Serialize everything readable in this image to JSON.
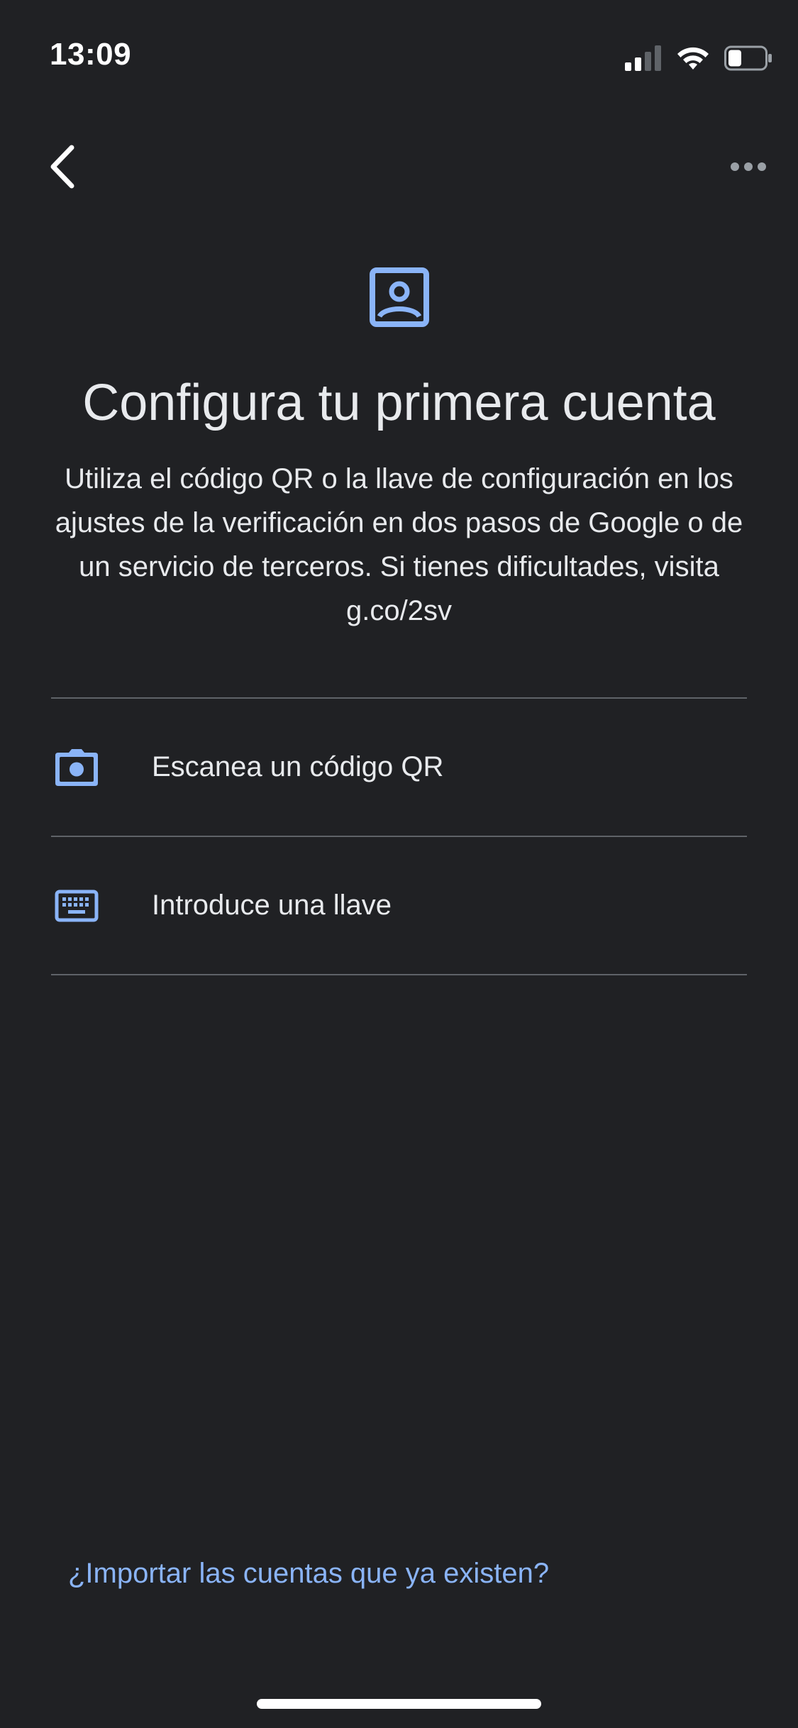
{
  "status_bar": {
    "time": "13:09"
  },
  "icons": {
    "back": "chevron-left-icon",
    "more": "more-horizontal-icon",
    "header": "account-box-icon",
    "camera": "camera-icon",
    "keyboard": "keyboard-icon"
  },
  "colors": {
    "background": "#202124",
    "accent": "#8ab4f8",
    "text": "#e8eaed",
    "divider": "#5f6368"
  },
  "main": {
    "title": "Configura tu primera cuenta",
    "description": "Utiliza el código QR o la llave de configuración en los ajustes de la verificación en dos pasos de Google o de un servicio de terceros. Si tienes dificultades, visita g.co/2sv"
  },
  "options": [
    {
      "label": "Escanea un código QR"
    },
    {
      "label": "Introduce una llave"
    }
  ],
  "footer": {
    "import_link": "¿Importar las cuentas que ya existen?"
  }
}
